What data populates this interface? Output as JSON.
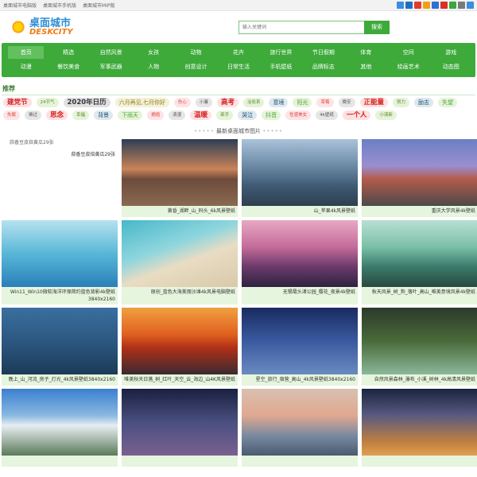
{
  "topbar": {
    "links": [
      "桌面城市电脑版",
      "桌面城市手机版",
      "桌面城市MIP版"
    ],
    "share_colors": [
      "#3b8ddf",
      "#1f6fbf",
      "#e03a2e",
      "#f29f1a",
      "#2f6fd6",
      "#d93025",
      "#3aa83a",
      "#7a7a7a",
      "#3b8ddf"
    ]
  },
  "logo": {
    "cn": "桌面城市",
    "en": "DESKCITY"
  },
  "search": {
    "placeholder": "输入关键词",
    "button": "搜索"
  },
  "nav": {
    "row1": [
      "首页",
      "精选",
      "自然风景",
      "女孩",
      "动物",
      "花卉",
      "旅行世界",
      "节日假期",
      "体育",
      "空间",
      "游戏"
    ],
    "row2": [
      "动漫",
      "餐饮美食",
      "军事武器",
      "人物",
      "创意设计",
      "日常生活",
      "手机壁纸",
      "品牌标志",
      "其他",
      "绘画艺术",
      "动态图"
    ]
  },
  "recommend_title": "推荐",
  "tags": [
    {
      "t": "建党节",
      "s": "lg",
      "bg": "#fde0e0",
      "c": "#d42020"
    },
    {
      "t": "24节气",
      "s": "sm",
      "bg": "#e6f3d8",
      "c": "#5a8b2e"
    },
    {
      "t": "2020年日历",
      "s": "lg",
      "bg": "#e1e1e1",
      "c": "#333333"
    },
    {
      "t": "六月再见,七月你好",
      "s": "md",
      "bg": "#f4f1d6",
      "c": "#8c8020"
    },
    {
      "t": "伤心",
      "s": "sm",
      "bg": "#fde4e4",
      "c": "#d44"
    },
    {
      "t": "小暑",
      "s": "sm",
      "bg": "#e6e6e6",
      "c": "#555"
    },
    {
      "t": "高考",
      "s": "lg",
      "bg": "#fde0e0",
      "c": "#d42020"
    },
    {
      "t": "治愈系",
      "s": "sm",
      "bg": "#e6f3d8",
      "c": "#5a8b2e"
    },
    {
      "t": "意境",
      "s": "md",
      "bg": "#dde9ef",
      "c": "#1f4f6f"
    },
    {
      "t": "阳光",
      "s": "md",
      "bg": "#e6f3d8",
      "c": "#4aa83a"
    },
    {
      "t": "草莓",
      "s": "sm",
      "bg": "#fde4e4",
      "c": "#d44"
    },
    {
      "t": "晚安",
      "s": "sm",
      "bg": "#e6e6e6",
      "c": "#555"
    },
    {
      "t": "正能量",
      "s": "lg",
      "bg": "#fde0e0",
      "c": "#d42020"
    },
    {
      "t": "努力",
      "s": "sm",
      "bg": "#e6f3d8",
      "c": "#5a8b2e"
    },
    {
      "t": "励志",
      "s": "md",
      "bg": "#dde9ef",
      "c": "#1f4f6f"
    },
    {
      "t": "失望",
      "s": "md",
      "bg": "#e6f3d8",
      "c": "#4aa83a"
    },
    {
      "t": "失眠",
      "s": "sm",
      "bg": "#fde4e4",
      "c": "#d44"
    },
    {
      "t": "难过",
      "s": "sm",
      "bg": "#e6e6e6",
      "c": "#555"
    },
    {
      "t": "思念",
      "s": "lg",
      "bg": "#fde0e0",
      "c": "#d42020"
    },
    {
      "t": "幸福",
      "s": "sm",
      "bg": "#e6f3d8",
      "c": "#5a8b2e"
    },
    {
      "t": "背景",
      "s": "md",
      "bg": "#dde9ef",
      "c": "#1f4f6f"
    },
    {
      "t": "下雨天",
      "s": "md",
      "bg": "#e6f3d8",
      "c": "#4aa83a"
    },
    {
      "t": "拥抱",
      "s": "sm",
      "bg": "#fde4e4",
      "c": "#d44"
    },
    {
      "t": "浪漫",
      "s": "sm",
      "bg": "#e6e6e6",
      "c": "#555"
    },
    {
      "t": "温暖",
      "s": "lg",
      "bg": "#fde0e0",
      "c": "#d42020"
    },
    {
      "t": "牵手",
      "s": "sm",
      "bg": "#e6f3d8",
      "c": "#5a8b2e"
    },
    {
      "t": "哭泣",
      "s": "md",
      "bg": "#dde9ef",
      "c": "#1f4f6f"
    },
    {
      "t": "抖音",
      "s": "md",
      "bg": "#e6f3d8",
      "c": "#4aa83a"
    },
    {
      "t": "性感美女",
      "s": "sm",
      "bg": "#fde4e4",
      "c": "#d44"
    },
    {
      "t": "4k壁纸",
      "s": "sm",
      "bg": "#e6e6e6",
      "c": "#555"
    },
    {
      "t": "一个人",
      "s": "lg",
      "bg": "#fde0e0",
      "c": "#d42020"
    },
    {
      "t": "小清新",
      "s": "sm",
      "bg": "#e6f3d8",
      "c": "#5a8b2e"
    }
  ],
  "section_title": "最新桌面城市图片",
  "cards": [
    {
      "cap": "蒜香豆皮焙黄瓜29张",
      "alt": "蒜香豆皮焙黄瓜29张",
      "broken": true,
      "bg": "#ffffff"
    },
    {
      "cap": "黄昏_湖畔_山_码头_6k风景壁纸",
      "bg": "linear-gradient(180deg,#2c3e56 0%,#c98457 45%,#6d4b3c 60%,#8a6a50 100%)"
    },
    {
      "cap": "山_苹果4k风景壁纸",
      "bg": "linear-gradient(180deg,#a9c3d9 0%,#6c8aa6 40%,#3f5a73 70%,#2e3f4f 100%)"
    },
    {
      "cap": "重庆大学风景4k壁纸",
      "bg": "linear-gradient(180deg,#6b7fc4 0%,#9a8fd0 40%,#b35a4a 60%,#4c4a4a 100%)"
    },
    {
      "cap": "Win11_Win10微软海洋环保简约蓝色背影4k壁纸3840x2160",
      "bg": "linear-gradient(180deg,#b6e2ee 0%,#58b7d8 50%,#2a7fb8 100%)"
    },
    {
      "cap": "原创_蓝色大海美丽沙滩4k风景电脑壁纸",
      "bg": "linear-gradient(160deg,#47b8c9 0%,#8fd6de 40%,#e9dcc3 60%,#d8c9a8 100%)"
    },
    {
      "cap": "无锡鼋头渚公园_樱花_夜景4k壁纸",
      "bg": "linear-gradient(180deg,#e8a9c3 0%,#c46b9a 40%,#6a3a6a 70%,#2f2240 100%)"
    },
    {
      "cap": "秋天风景_树_狗_落叶_高山_唯美意境风景4k壁纸",
      "bg": "linear-gradient(180deg,#b8e0d2 0%,#7bc0a8 40%,#3a7a6a 70%,#2a4a40 100%)"
    },
    {
      "cap": "晚上_山_河流_房子_灯光_4k风景壁纸3840x2160",
      "bg": "linear-gradient(180deg,#3a6fa0 0%,#2c5880 50%,#1c3a58 100%)"
    },
    {
      "cap": "唯美秋天日落_树_红叶_天空_云_海边_山4K风景壁纸",
      "bg": "linear-gradient(180deg,#f0a040 0%,#e06020 40%,#b03018 60%,#3a2a30 100%)"
    },
    {
      "cap": "星空_旅行_宿营_高山_4k风景壁纸3840x2160",
      "bg": "linear-gradient(180deg,#1a2a60 0%,#3a5aa0 50%,#6a8ac0 100%)"
    },
    {
      "cap": "自然风景森林_瀑布_小溪_树林_4k高清风景壁纸",
      "bg": "linear-gradient(180deg,#2a3a2a 0%,#4a6a3a 50%,#8ab89a 100%)"
    },
    {
      "cap": "",
      "bg": "linear-gradient(180deg,#3a80d0 0%,#8ab8e0 40%,#e8eef2 55%,#5a7a5a 100%)"
    },
    {
      "cap": "",
      "bg": "linear-gradient(180deg,#1a2040 0%,#4a5080 50%,#7a6090 100%)"
    },
    {
      "cap": "",
      "bg": "linear-gradient(180deg,#d8c0b0 0%,#e0a890 40%,#7a8aa0 70%,#4a5a70 100%)"
    },
    {
      "cap": "",
      "bg": "linear-gradient(180deg,#1a2440 0%,#5a5a80 40%,#c08040 80%,#e0a050 100%)"
    }
  ]
}
